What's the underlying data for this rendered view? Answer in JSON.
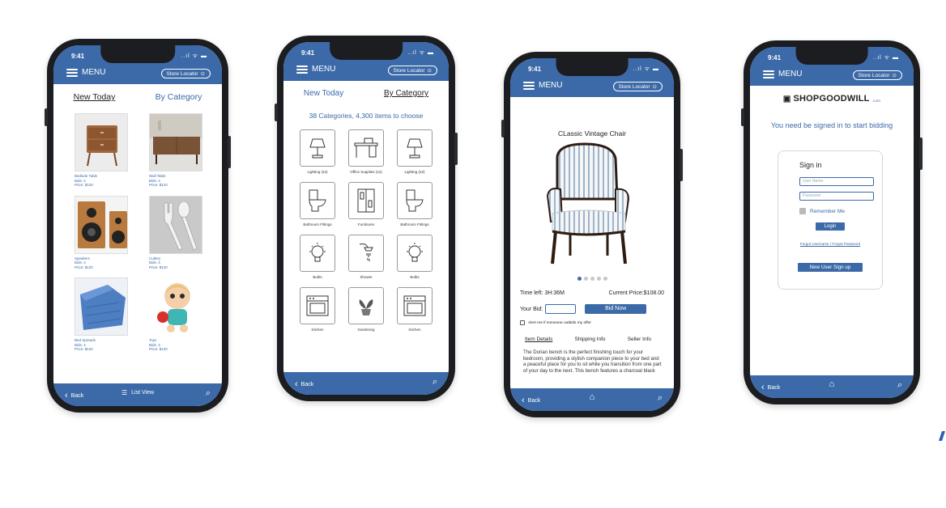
{
  "status": {
    "time": "9:41",
    "icons": "..ıl ᯤ ▬"
  },
  "header": {
    "menu_label": "MENU",
    "store_locator": "Store Locator"
  },
  "phone1": {
    "tabs": [
      "New Today",
      "By Category"
    ],
    "products": [
      {
        "name": "Bedside Table",
        "bids": "Bids: 4",
        "price": "Price: $120"
      },
      {
        "name": "Wall Table",
        "bids": "Bids: 4",
        "price": "Price: $120"
      },
      {
        "name": "Speakers",
        "bids": "Bids: 4",
        "price": "Price: $120"
      },
      {
        "name": "Cutlery",
        "bids": "Bids: 4",
        "price": "Price: $120"
      },
      {
        "name": "Bed Spreads",
        "bids": "Bids: 4",
        "price": "Price: $120"
      },
      {
        "name": "Toys",
        "bids": "Bids: 4",
        "price": "Price: $120"
      }
    ],
    "bottom": {
      "back": "Back",
      "list_view": "List View"
    }
  },
  "phone2": {
    "tabs": [
      "New Today",
      "By Category"
    ],
    "summary": "38 Categories,  4,300 items to choose",
    "categories": [
      {
        "label": "Lighting (22)",
        "icon": "lamp-icon"
      },
      {
        "label": "Office Supplies (12)",
        "icon": "desk-icon"
      },
      {
        "label": "Lighting (22)",
        "icon": "lamp-icon"
      },
      {
        "label": "Bathroom Fittings",
        "icon": "toilet-icon"
      },
      {
        "label": "Furnitures",
        "icon": "cabinet-icon"
      },
      {
        "label": "Bathroom Fittings",
        "icon": "toilet-icon"
      },
      {
        "label": "Bulbs",
        "icon": "bulb-icon"
      },
      {
        "label": "Shower",
        "icon": "shower-icon"
      },
      {
        "label": "Bulbs",
        "icon": "bulb-icon"
      },
      {
        "label": "Kitchen",
        "icon": "oven-icon"
      },
      {
        "label": "Gardening",
        "icon": "plant-icon"
      },
      {
        "label": "Kitchen",
        "icon": "oven-icon"
      }
    ],
    "bottom": {
      "back": "Back"
    }
  },
  "phone3": {
    "title": "CLassic Vintage  Chair",
    "carousel": {
      "count": 5,
      "active": 0
    },
    "time_left": "Time left: 3H:36M",
    "current_price": "Current Price:$108.00",
    "your_bid_label": "Your Bid:",
    "bid_button": "Bid Now",
    "alert_text": "Alert me if someone outbids my offer",
    "tabs": [
      "Item Details",
      "Shipping Info",
      "Seller  Info"
    ],
    "description": "The Dorian bench is the perfect finishing touch for your bedroom, providing a stylish companion piece to your bed and a peaceful place for you to sit while you transition from one part of your day to the next. This bench features a charcoal black",
    "bottom": {
      "back": "Back"
    }
  },
  "phone4": {
    "logo": "SHOPGOODWILL",
    "logo_suffix": ".com",
    "message": "You need  be signed in to start bidding",
    "signin": {
      "title": "Sign in",
      "username_placeholder": "User Name",
      "password_placeholder": "Password",
      "remember": "Remember Me",
      "login": "Login",
      "forgot": "Forgot Username / Forgot Password",
      "signup": "New User Sign up"
    },
    "bottom": {
      "back": "Back"
    }
  },
  "colors": {
    "brand": "#3c6aa8",
    "phone_body": "#1c1d20"
  }
}
